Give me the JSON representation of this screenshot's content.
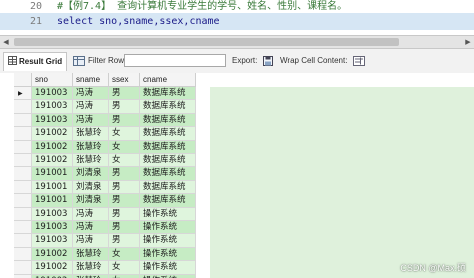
{
  "editor": {
    "lines": [
      {
        "num": "20",
        "text": "#【例7.4】 查询计算机专业学生的学号、姓名、性别、课程名。"
      },
      {
        "num": "21",
        "text": "select sno,sname,ssex,cname"
      }
    ]
  },
  "toolbar": {
    "result_grid_label": "Result Grid",
    "filter_rows_label": "Filter Rows:",
    "filter_rows_value": "",
    "export_label": "Export:",
    "wrap_cell_label": "Wrap Cell Content:"
  },
  "grid": {
    "columns": [
      "sno",
      "sname",
      "ssex",
      "cname"
    ],
    "rows": [
      [
        "191003",
        "冯涛",
        "男",
        "数据库系统"
      ],
      [
        "191003",
        "冯涛",
        "男",
        "数据库系统"
      ],
      [
        "191003",
        "冯涛",
        "男",
        "数据库系统"
      ],
      [
        "191002",
        "张慧玲",
        "女",
        "数据库系统"
      ],
      [
        "191002",
        "张慧玲",
        "女",
        "数据库系统"
      ],
      [
        "191002",
        "张慧玲",
        "女",
        "数据库系统"
      ],
      [
        "191001",
        "刘清泉",
        "男",
        "数据库系统"
      ],
      [
        "191001",
        "刘清泉",
        "男",
        "数据库系统"
      ],
      [
        "191001",
        "刘清泉",
        "男",
        "数据库系统"
      ],
      [
        "191003",
        "冯涛",
        "男",
        "操作系统"
      ],
      [
        "191003",
        "冯涛",
        "男",
        "操作系统"
      ],
      [
        "191003",
        "冯涛",
        "男",
        "操作系统"
      ],
      [
        "191002",
        "张慧玲",
        "女",
        "操作系统"
      ],
      [
        "191002",
        "张慧玲",
        "女",
        "操作系统"
      ],
      [
        "191002",
        "张慧玲",
        "女",
        "操作系统"
      ]
    ],
    "row_colors": {
      "odd": "#c6ecc4",
      "even": "#dff5dd"
    }
  },
  "watermark": "CSDN @Max.硕"
}
